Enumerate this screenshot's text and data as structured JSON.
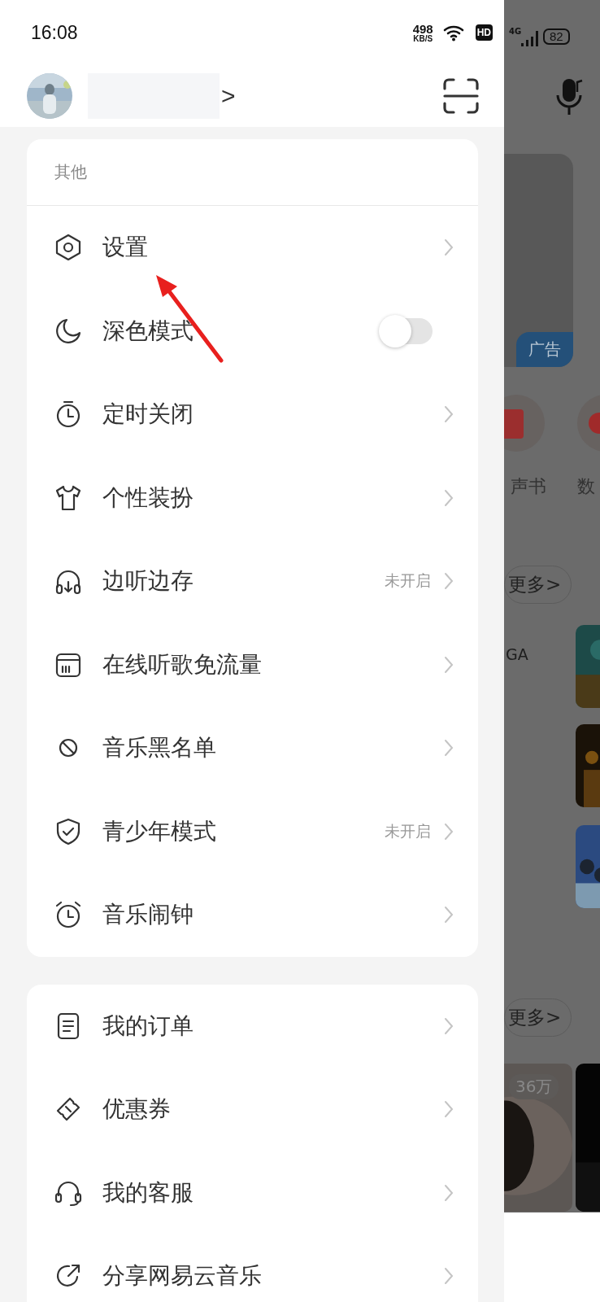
{
  "status_bar": {
    "time": "16:08",
    "net_speed": "498",
    "net_unit": "KB/S",
    "hd": "HD",
    "network": "4G",
    "battery": "82"
  },
  "profile": {
    "chevron": ">"
  },
  "sections": [
    {
      "title": "其他",
      "items": [
        {
          "kind": "link",
          "label": "设置"
        },
        {
          "kind": "toggle",
          "label": "深色模式",
          "on": false
        },
        {
          "kind": "link",
          "label": "定时关闭"
        },
        {
          "kind": "link",
          "label": "个性装扮"
        },
        {
          "kind": "link",
          "label": "边听边存",
          "status": "未开启"
        },
        {
          "kind": "link",
          "label": "在线听歌免流量"
        },
        {
          "kind": "link",
          "label": "音乐黑名单"
        },
        {
          "kind": "link",
          "label": "青少年模式",
          "status": "未开启"
        },
        {
          "kind": "link",
          "label": "音乐闹钟"
        }
      ]
    },
    {
      "items": [
        {
          "kind": "link",
          "label": "我的订单"
        },
        {
          "kind": "link",
          "label": "优惠券"
        },
        {
          "kind": "link",
          "label": "我的客服"
        },
        {
          "kind": "link",
          "label": "分享网易云音乐"
        }
      ]
    }
  ],
  "background": {
    "ad_badge": "广告",
    "labels": [
      "声书",
      "数"
    ],
    "more": [
      "更多>",
      "更多>"
    ],
    "caption": "GA",
    "play_count": "36万"
  }
}
